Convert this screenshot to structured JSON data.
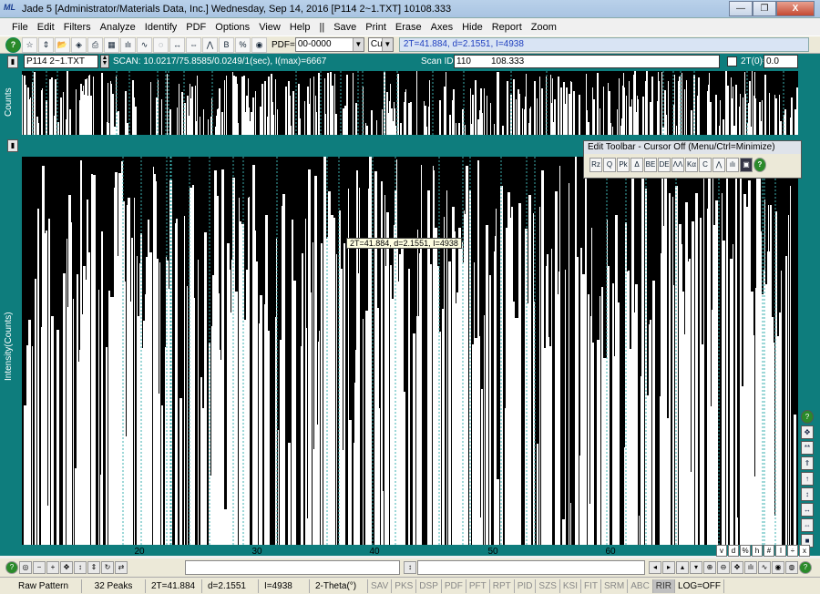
{
  "window": {
    "title": "Jade 5 [Administrator/Materials Data, Inc.] Wednesday, Sep 14, 2016 [P114 2~1.TXT]  10108.333",
    "logo_text": "ML",
    "buttons": [
      "—",
      "❐",
      "X"
    ]
  },
  "menu": [
    "File",
    "Edit",
    "Filters",
    "Analyze",
    "Identify",
    "PDF",
    "Options",
    "View",
    "Help",
    "||",
    "Save",
    "Print",
    "Erase",
    "Axes",
    "Hide",
    "Report",
    "Zoom"
  ],
  "toolbar": {
    "icons": [
      "help-icon",
      "peak-icon",
      "updown-icon",
      "open-icon",
      "erase-icon",
      "print-icon",
      "save-icon",
      "bars-icon",
      "wave-icon",
      "circle-icon",
      "spread-icon",
      "arrows-icon",
      "peaks-icon",
      "bg-icon",
      "percent-icon",
      "globe-icon"
    ],
    "pdf_label": "PDF=",
    "pdf_value": "00-0000",
    "anode_value": "Cu",
    "cursor_readout": "2T=41.884, d=2.1551, I=4938"
  },
  "scan": {
    "file": "P114 2~1.TXT",
    "scan_text": "SCAN: 10.0217/75.8585/0.0249/1(sec), I(max)=6667",
    "scan_id_label": "Scan ID:",
    "scan_id_value": "110",
    "scan_id_number": "108.333",
    "two_theta_zero_label": "2T(0)=",
    "two_theta_zero_value": "0.0"
  },
  "overview": {
    "ylabel": "Counts"
  },
  "mainplot": {
    "ylabel": "Intensity(Counts)",
    "xlabel_ticks": [
      "20",
      "30",
      "40",
      "50",
      "60"
    ],
    "tooltip": "2T=41.884, d=2.1551, I=4938"
  },
  "edit_toolbar": {
    "title": "Edit Toolbar - Cursor Off (Menu/Ctrl=Minimize)",
    "buttons": [
      "Rz",
      "Q",
      "Pk",
      "Δ",
      "BE",
      "DE",
      "ΛΛ",
      "Kα",
      "C",
      "⋀",
      "ılı",
      "▣",
      "?"
    ]
  },
  "side_letters": [
    "v",
    "d",
    "%",
    "h",
    "#",
    "I",
    "÷",
    "x"
  ],
  "status": {
    "items": [
      "Raw Pattern",
      "32 Peaks",
      "2T=41.884",
      "d=2.1551",
      "I=4938",
      "2-Theta(°)"
    ],
    "flags": [
      "SAV",
      "PKS",
      "DSP",
      "PDF",
      "PFT",
      "RPT",
      "PID",
      "SZS",
      "KSI",
      "FIT",
      "SRM",
      "ABC",
      "RIR",
      "LOG=OFF"
    ]
  }
}
